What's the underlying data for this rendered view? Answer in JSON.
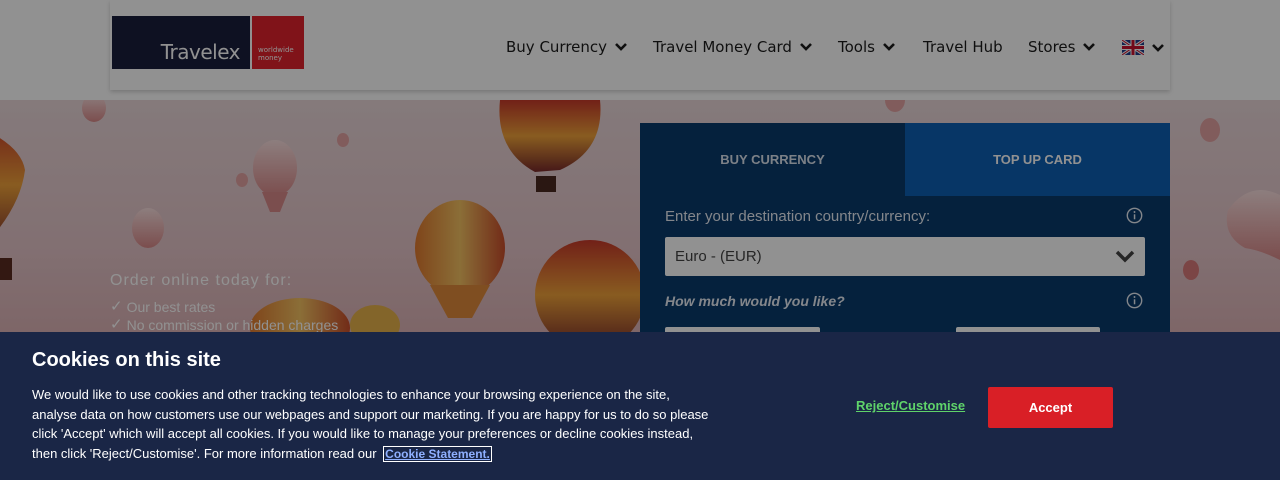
{
  "brand": {
    "name": "Travelex",
    "tagline": "worldwide money",
    "primary_color": "#1a1f3d",
    "accent_color": "#e2232c"
  },
  "nav": {
    "items": [
      {
        "label": "Buy Currency",
        "has_dropdown": true
      },
      {
        "label": "Travel Money Card",
        "has_dropdown": true
      },
      {
        "label": "Tools",
        "has_dropdown": true
      },
      {
        "label": "Travel Hub",
        "has_dropdown": false
      },
      {
        "label": "Stores",
        "has_dropdown": true
      }
    ],
    "language_flag": "uk-flag-icon"
  },
  "promo": {
    "title": "Order online today for:",
    "items": [
      "Our best rates",
      "No commission or hidden charges"
    ]
  },
  "widget": {
    "tabs": [
      "BUY CURRENCY",
      "TOP UP CARD"
    ],
    "destination_label": "Enter your destination country/currency:",
    "currency_selected": "Euro - (EUR)",
    "amount_label": "How much would you like?"
  },
  "cookie_banner": {
    "title": "Cookies on this site",
    "body": "We would like to use cookies and other tracking technologies to enhance your browsing experience on the site, analyse data on how customers use our webpages and support our marketing. If you are happy for us to do so please click 'Accept' which will accept all cookies. If you would like to manage your preferences or decline cookies instead, then click 'Reject/Customise'. For more information read our",
    "link": "Cookie Statement.",
    "reject_label": "Reject/Customise",
    "accept_label": "Accept",
    "accept_color": "#d91f26"
  }
}
